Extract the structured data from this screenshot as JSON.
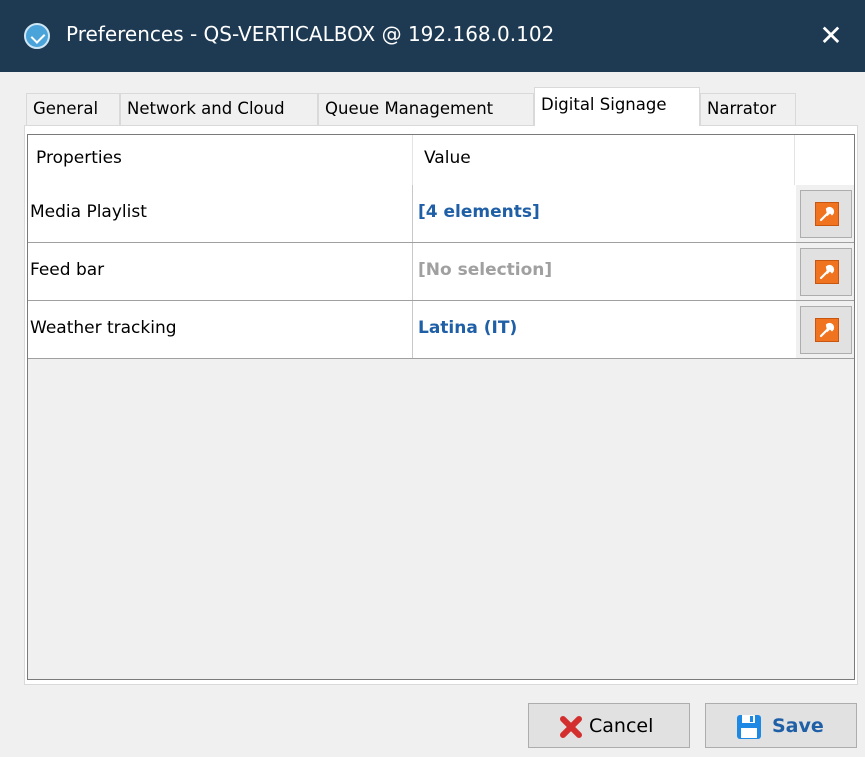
{
  "window": {
    "title": "Preferences - QS-VERTICALBOX @ 192.168.0.102",
    "close_symbol": "✕"
  },
  "tabs": [
    {
      "label": "General"
    },
    {
      "label": "Network and Cloud"
    },
    {
      "label": "Queue Management"
    },
    {
      "label": "Digital Signage",
      "active": true
    },
    {
      "label": "Narrator"
    }
  ],
  "table": {
    "headers": {
      "properties": "Properties",
      "value": "Value"
    },
    "rows": [
      {
        "property": "Media Playlist",
        "value": "[4 elements]",
        "value_color": "#1f5fa6"
      },
      {
        "property": "Feed bar",
        "value": "[No selection]",
        "value_color": "#a0a0a0"
      },
      {
        "property": "Weather tracking",
        "value": "Latina (IT)",
        "value_color": "#1f5fa6"
      }
    ]
  },
  "buttons": {
    "cancel": "Cancel",
    "save": "Save"
  },
  "colors": {
    "titlebar": "#1e3a53",
    "tool_icon": "#f0741f",
    "cancel_icon": "#d32f2f",
    "save_icon": "#1e88e5",
    "link_value": "#1f5fa6",
    "empty_value": "#a0a0a0"
  },
  "icons": {
    "app": "app-logo-icon",
    "close": "close-icon",
    "tool": "wrench-icon",
    "cancel": "cancel-x-icon",
    "save": "floppy-disk-icon"
  }
}
